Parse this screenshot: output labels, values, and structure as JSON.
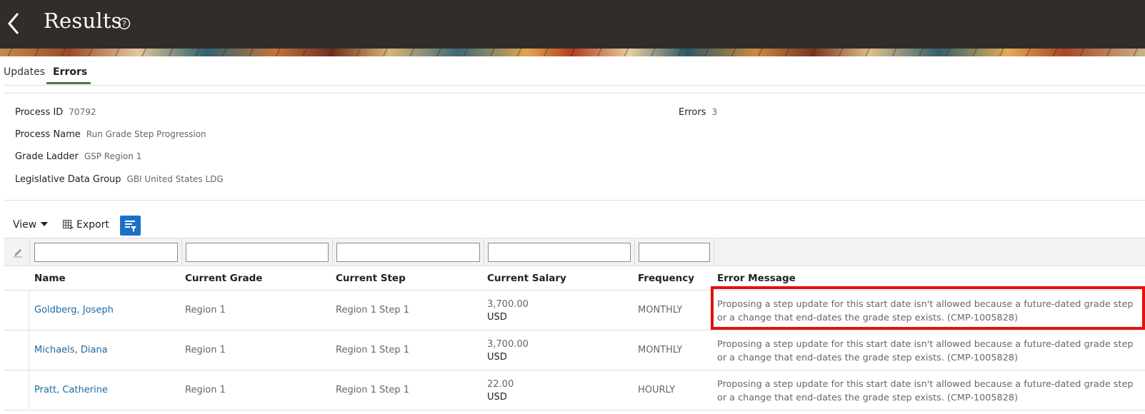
{
  "header": {
    "title": "Results"
  },
  "tabs": [
    {
      "label": "Updates"
    },
    {
      "label": "Errors"
    }
  ],
  "details": {
    "process_id": {
      "label": "Process ID",
      "value": "70792"
    },
    "process_name": {
      "label": "Process Name",
      "value": "Run Grade Step Progression"
    },
    "grade_ladder": {
      "label": "Grade Ladder",
      "value": "GSP Region 1"
    },
    "ldg": {
      "label": "Legislative Data Group",
      "value": "GBI United States LDG"
    },
    "errors": {
      "label": "Errors",
      "value": "3"
    }
  },
  "toolbar": {
    "view_label": "View",
    "export_label": "Export"
  },
  "table": {
    "columns": [
      "Name",
      "Current Grade",
      "Current Step",
      "Current Salary",
      "Frequency",
      "Error Message"
    ],
    "rows": [
      {
        "name": "Goldberg, Joseph",
        "grade": "Region 1",
        "step": "Region 1 Step 1",
        "salary": "3,700.00",
        "currency": "USD",
        "frequency": "MONTHLY",
        "error": "Proposing a step update for this start date isn't allowed because a future-dated grade step or a change that end-dates the grade step exists. (CMP-1005828)"
      },
      {
        "name": "Michaels, Diana",
        "grade": "Region 1",
        "step": "Region 1 Step 1",
        "salary": "3,700.00",
        "currency": "USD",
        "frequency": "MONTHLY",
        "error": "Proposing a step update for this start date isn't allowed because a future-dated grade step or a change that end-dates the grade step exists. (CMP-1005828)"
      },
      {
        "name": "Pratt, Catherine",
        "grade": "Region 1",
        "step": "Region 1 Step 1",
        "salary": "22.00",
        "currency": "USD",
        "frequency": "HOURLY",
        "error": "Proposing a step update for this start date isn't allowed because a future-dated grade step or a change that end-dates the grade step exists. (CMP-1005828)"
      }
    ]
  },
  "colors": {
    "header_bg": "#312d2a",
    "tab_accent": "#4d7a3b",
    "link": "#1c6aa3",
    "filter_button": "#1d6fc7",
    "highlight": "#e50f0f"
  },
  "icons": [
    "back-chevron-icon",
    "help-icon",
    "export-icon",
    "filter-icon",
    "pencil-icon"
  ]
}
